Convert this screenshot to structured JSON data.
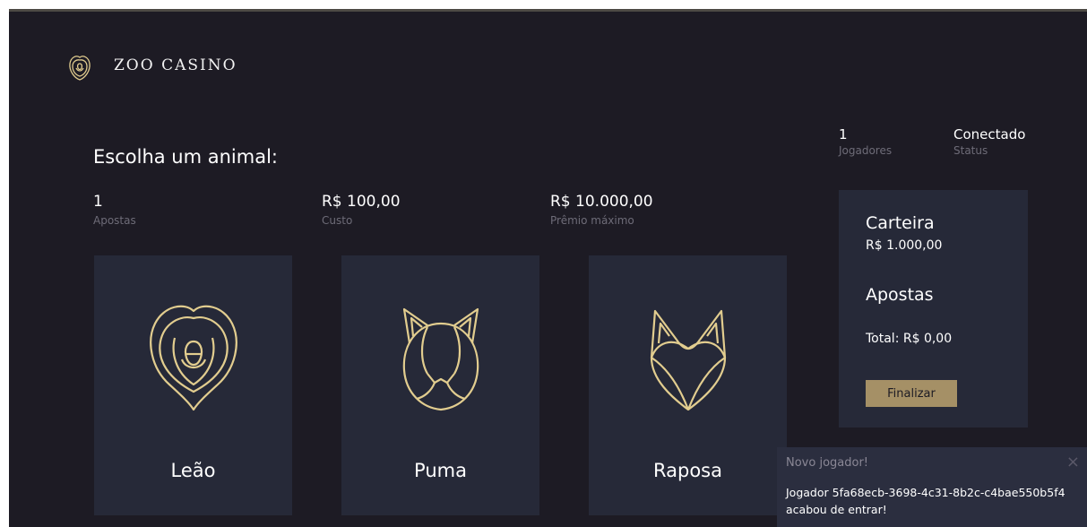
{
  "brand": {
    "name": "ZOO CASINO"
  },
  "header_stats": {
    "players": {
      "value": "1",
      "label": "Jogadores"
    },
    "status": {
      "value": "Conectado",
      "label": "Status"
    }
  },
  "main": {
    "title": "Escolha um animal:",
    "stats": [
      {
        "value": "1",
        "label": "Apostas"
      },
      {
        "value": "R$ 100,00",
        "label": "Custo"
      },
      {
        "value": "R$ 10.000,00",
        "label": "Prêmio máximo"
      }
    ],
    "animals": [
      {
        "name": "Leão",
        "icon": "lion-icon"
      },
      {
        "name": "Puma",
        "icon": "puma-icon"
      },
      {
        "name": "Raposa",
        "icon": "fox-icon"
      }
    ]
  },
  "wallet": {
    "title": "Carteira",
    "balance": "R$ 1.000,00",
    "bets_title": "Apostas",
    "total": "Total: R$ 0,00",
    "finalize_label": "Finalizar"
  },
  "toast": {
    "title": "Novo jogador!",
    "message": "Jogador 5fa68ecb-3698-4c31-8b2c-c4bae550b5f4 acabou de entrar!",
    "close": "×"
  },
  "colors": {
    "background": "#1d1b24",
    "card": "#262938",
    "accent": "#a59066",
    "icon_stroke": "#e2cd8f",
    "muted_text": "#6e6c78"
  }
}
